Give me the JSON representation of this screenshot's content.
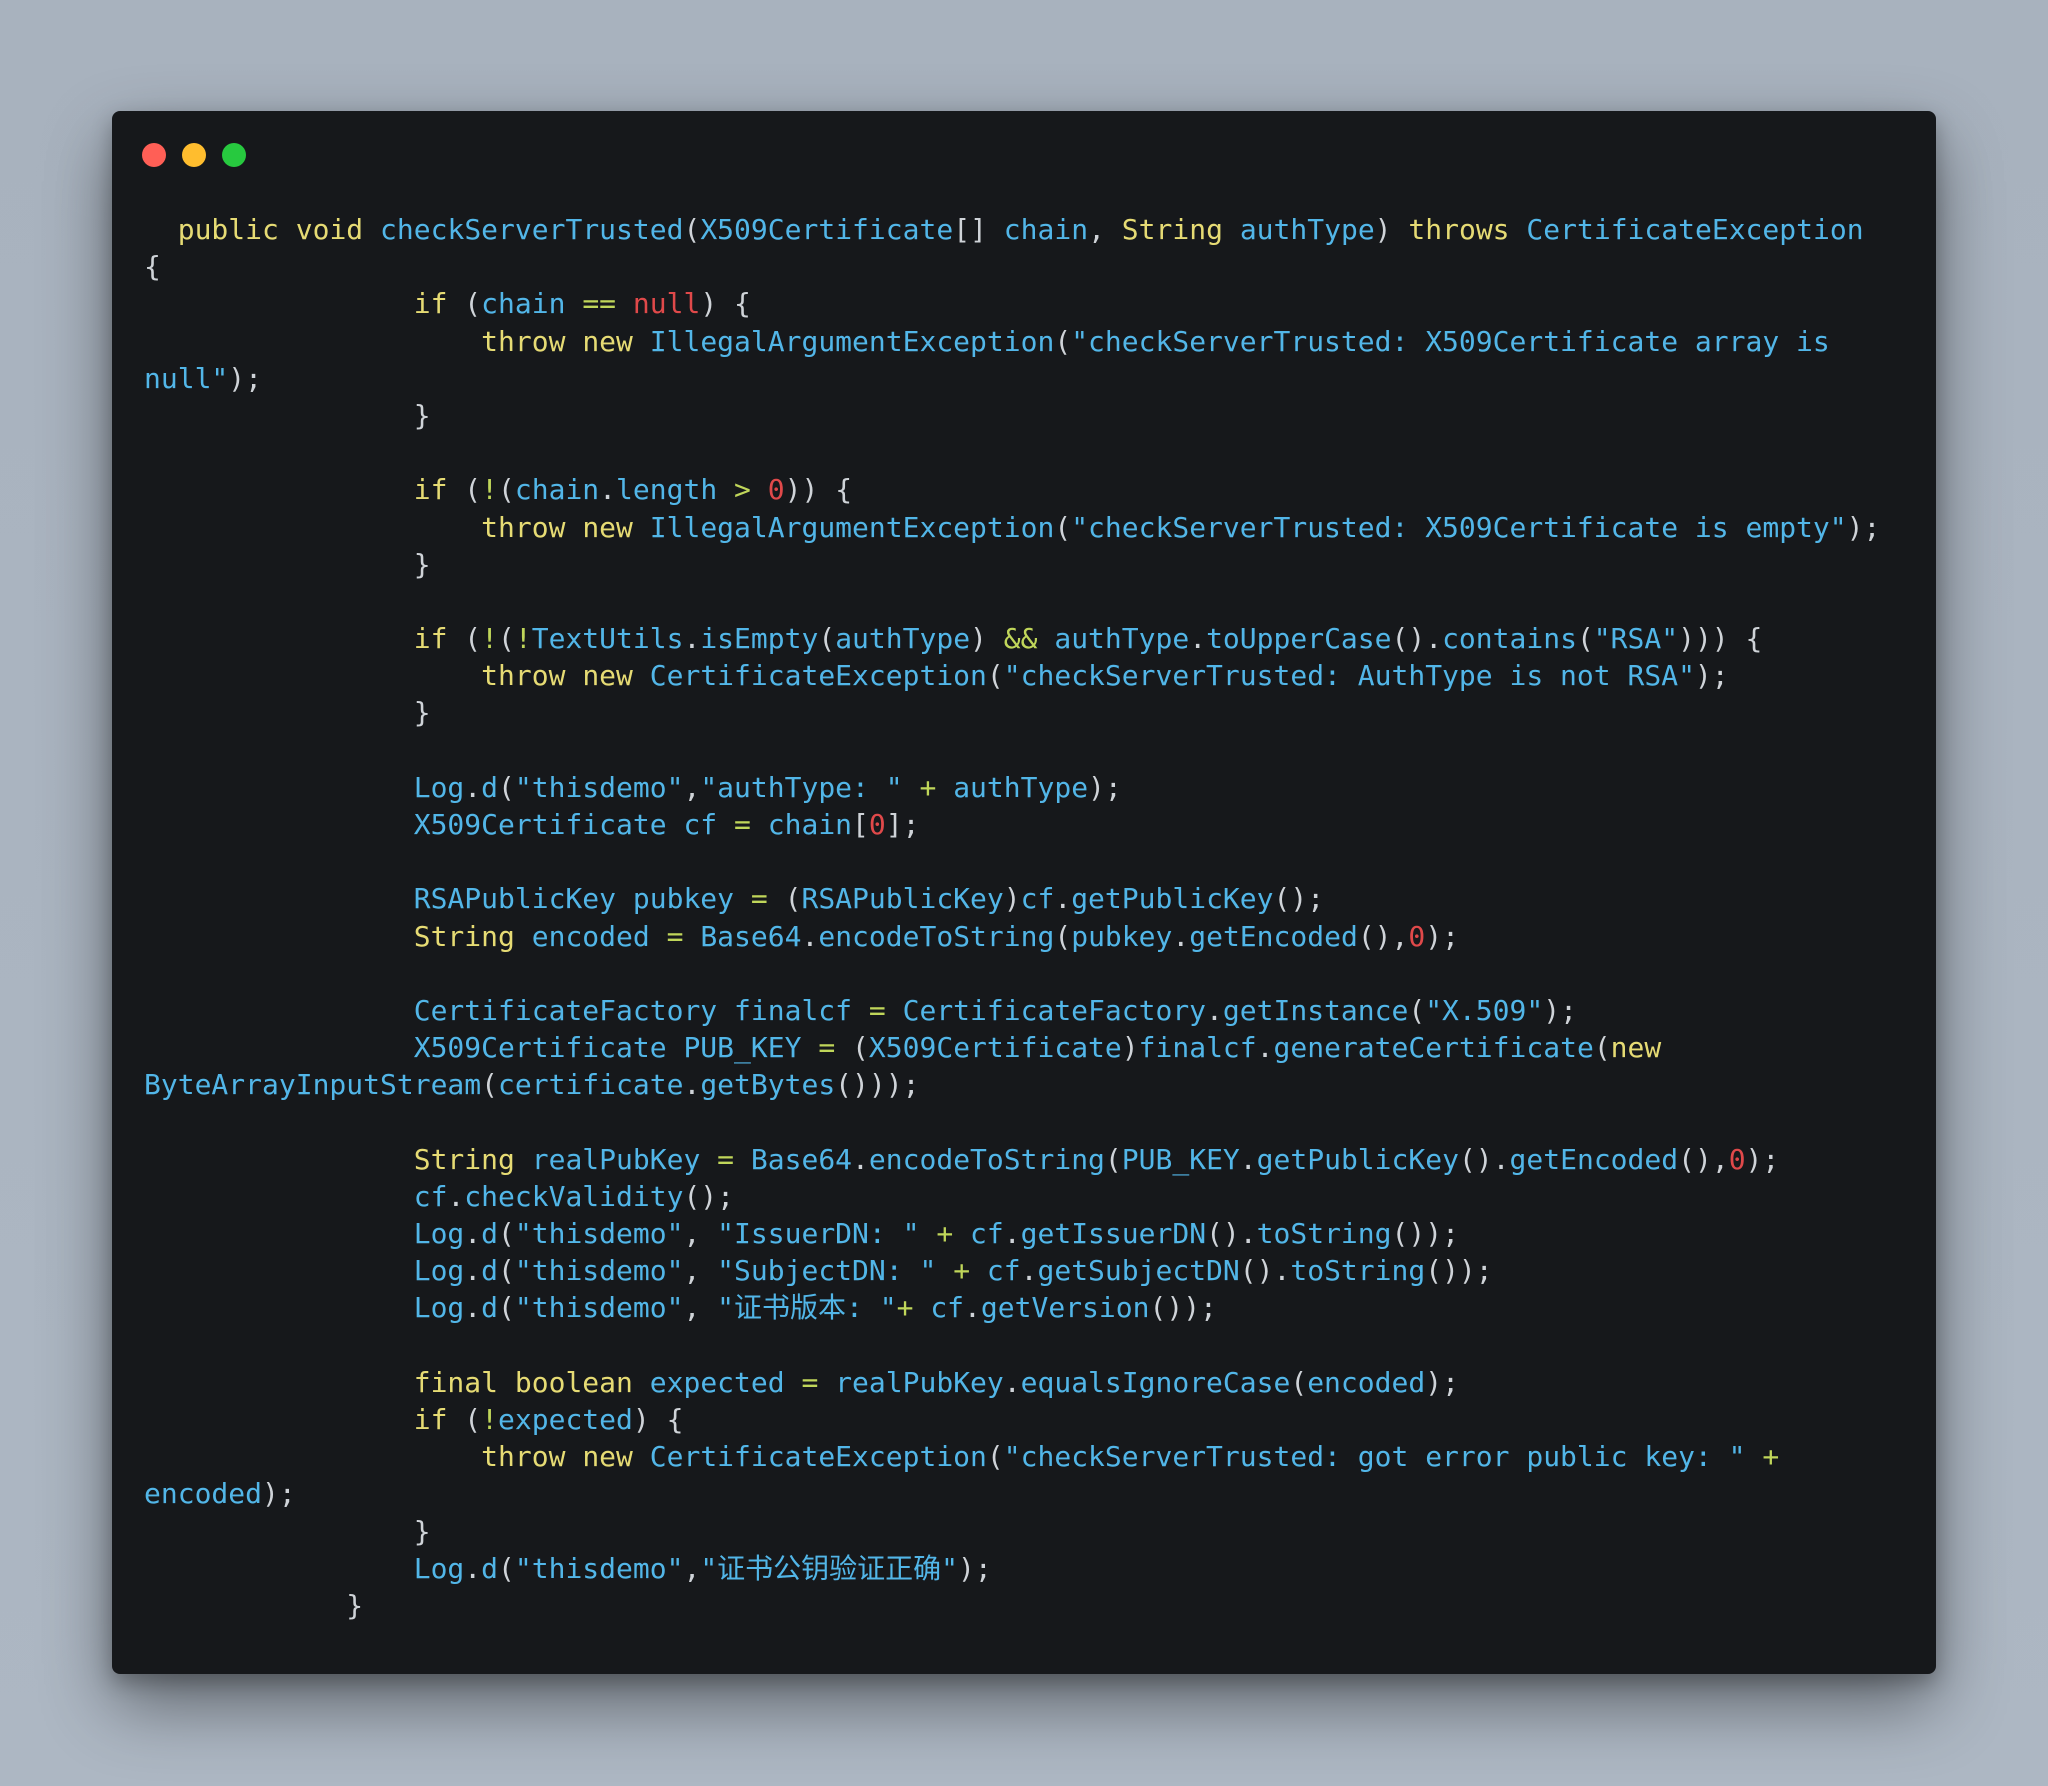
{
  "window": {
    "controls": [
      "close",
      "minimize",
      "zoom"
    ],
    "control_colors": {
      "close": "#ff5f56",
      "minimize": "#ffbd2e",
      "zoom": "#27c93f"
    }
  },
  "code": {
    "language": "java",
    "lines": [
      [
        [
          "pun",
          "  "
        ],
        [
          "kw",
          "public"
        ],
        [
          "pun",
          " "
        ],
        [
          "kw",
          "void"
        ],
        [
          "pun",
          " "
        ],
        [
          "fn",
          "checkServerTrusted"
        ],
        [
          "pun",
          "("
        ],
        [
          "id",
          "X509Certificate"
        ],
        [
          "pun",
          "[] "
        ],
        [
          "id",
          "chain"
        ],
        [
          "pun",
          ", "
        ],
        [
          "ty",
          "String"
        ],
        [
          "pun",
          " "
        ],
        [
          "id",
          "authType"
        ],
        [
          "pun",
          ") "
        ],
        [
          "kw",
          "throws"
        ],
        [
          "pun",
          " "
        ],
        [
          "id",
          "CertificateException"
        ]
      ],
      [
        [
          "pun",
          "{"
        ]
      ],
      [
        [
          "pun",
          "                "
        ],
        [
          "kw",
          "if"
        ],
        [
          "pun",
          " ("
        ],
        [
          "id",
          "chain"
        ],
        [
          "pun",
          " "
        ],
        [
          "op",
          "=="
        ],
        [
          "pun",
          " "
        ],
        [
          "nul",
          "null"
        ],
        [
          "pun",
          ") {"
        ]
      ],
      [
        [
          "pun",
          "                    "
        ],
        [
          "kw",
          "throw"
        ],
        [
          "pun",
          " "
        ],
        [
          "kw",
          "new"
        ],
        [
          "pun",
          " "
        ],
        [
          "fn",
          "IllegalArgumentException"
        ],
        [
          "pun",
          "("
        ],
        [
          "str",
          "\"checkServerTrusted: X509Certificate array is"
        ]
      ],
      [
        [
          "str",
          "null\""
        ],
        [
          "pun",
          ");"
        ]
      ],
      [
        [
          "pun",
          "                }"
        ]
      ],
      [
        [
          "pun",
          ""
        ]
      ],
      [
        [
          "pun",
          "                "
        ],
        [
          "kw",
          "if"
        ],
        [
          "pun",
          " ("
        ],
        [
          "op",
          "!"
        ],
        [
          "pun",
          "("
        ],
        [
          "id",
          "chain"
        ],
        [
          "pun",
          "."
        ],
        [
          "id",
          "length"
        ],
        [
          "pun",
          " "
        ],
        [
          "op",
          ">"
        ],
        [
          "pun",
          " "
        ],
        [
          "num",
          "0"
        ],
        [
          "pun",
          ")) {"
        ]
      ],
      [
        [
          "pun",
          "                    "
        ],
        [
          "kw",
          "throw"
        ],
        [
          "pun",
          " "
        ],
        [
          "kw",
          "new"
        ],
        [
          "pun",
          " "
        ],
        [
          "fn",
          "IllegalArgumentException"
        ],
        [
          "pun",
          "("
        ],
        [
          "str",
          "\"checkServerTrusted: X509Certificate is empty\""
        ],
        [
          "pun",
          ");"
        ]
      ],
      [
        [
          "pun",
          "                }"
        ]
      ],
      [
        [
          "pun",
          ""
        ]
      ],
      [
        [
          "pun",
          "                "
        ],
        [
          "kw",
          "if"
        ],
        [
          "pun",
          " ("
        ],
        [
          "op",
          "!"
        ],
        [
          "pun",
          "("
        ],
        [
          "op",
          "!"
        ],
        [
          "id",
          "TextUtils"
        ],
        [
          "pun",
          "."
        ],
        [
          "fn",
          "isEmpty"
        ],
        [
          "pun",
          "("
        ],
        [
          "id",
          "authType"
        ],
        [
          "pun",
          ") "
        ],
        [
          "op",
          "&&"
        ],
        [
          "pun",
          " "
        ],
        [
          "id",
          "authType"
        ],
        [
          "pun",
          "."
        ],
        [
          "fn",
          "toUpperCase"
        ],
        [
          "pun",
          "()."
        ],
        [
          "fn",
          "contains"
        ],
        [
          "pun",
          "("
        ],
        [
          "str",
          "\"RSA\""
        ],
        [
          "pun",
          "))) {"
        ]
      ],
      [
        [
          "pun",
          "                    "
        ],
        [
          "kw",
          "throw"
        ],
        [
          "pun",
          " "
        ],
        [
          "kw",
          "new"
        ],
        [
          "pun",
          " "
        ],
        [
          "fn",
          "CertificateException"
        ],
        [
          "pun",
          "("
        ],
        [
          "str",
          "\"checkServerTrusted: AuthType is not RSA\""
        ],
        [
          "pun",
          ");"
        ]
      ],
      [
        [
          "pun",
          "                }"
        ]
      ],
      [
        [
          "pun",
          ""
        ]
      ],
      [
        [
          "pun",
          "                "
        ],
        [
          "id",
          "Log"
        ],
        [
          "pun",
          "."
        ],
        [
          "fn",
          "d"
        ],
        [
          "pun",
          "("
        ],
        [
          "str",
          "\"thisdemo\""
        ],
        [
          "pun",
          ","
        ],
        [
          "str",
          "\"authType: \""
        ],
        [
          "pun",
          " "
        ],
        [
          "op",
          "+"
        ],
        [
          "pun",
          " "
        ],
        [
          "id",
          "authType"
        ],
        [
          "pun",
          ");"
        ]
      ],
      [
        [
          "pun",
          "                "
        ],
        [
          "id",
          "X509Certificate"
        ],
        [
          "pun",
          " "
        ],
        [
          "id",
          "cf"
        ],
        [
          "pun",
          " "
        ],
        [
          "op",
          "="
        ],
        [
          "pun",
          " "
        ],
        [
          "id",
          "chain"
        ],
        [
          "pun",
          "["
        ],
        [
          "num",
          "0"
        ],
        [
          "pun",
          "];"
        ]
      ],
      [
        [
          "pun",
          ""
        ]
      ],
      [
        [
          "pun",
          "                "
        ],
        [
          "id",
          "RSAPublicKey"
        ],
        [
          "pun",
          " "
        ],
        [
          "id",
          "pubkey"
        ],
        [
          "pun",
          " "
        ],
        [
          "op",
          "="
        ],
        [
          "pun",
          " ("
        ],
        [
          "id",
          "RSAPublicKey"
        ],
        [
          "pun",
          ")"
        ],
        [
          "id",
          "cf"
        ],
        [
          "pun",
          "."
        ],
        [
          "fn",
          "getPublicKey"
        ],
        [
          "pun",
          "();"
        ]
      ],
      [
        [
          "pun",
          "                "
        ],
        [
          "ty",
          "String"
        ],
        [
          "pun",
          " "
        ],
        [
          "id",
          "encoded"
        ],
        [
          "pun",
          " "
        ],
        [
          "op",
          "="
        ],
        [
          "pun",
          " "
        ],
        [
          "id",
          "Base64"
        ],
        [
          "pun",
          "."
        ],
        [
          "fn",
          "encodeToString"
        ],
        [
          "pun",
          "("
        ],
        [
          "id",
          "pubkey"
        ],
        [
          "pun",
          "."
        ],
        [
          "fn",
          "getEncoded"
        ],
        [
          "pun",
          "(),"
        ],
        [
          "num",
          "0"
        ],
        [
          "pun",
          ");"
        ]
      ],
      [
        [
          "pun",
          ""
        ]
      ],
      [
        [
          "pun",
          "                "
        ],
        [
          "id",
          "CertificateFactory"
        ],
        [
          "pun",
          " "
        ],
        [
          "id",
          "finalcf"
        ],
        [
          "pun",
          " "
        ],
        [
          "op",
          "="
        ],
        [
          "pun",
          " "
        ],
        [
          "id",
          "CertificateFactory"
        ],
        [
          "pun",
          "."
        ],
        [
          "fn",
          "getInstance"
        ],
        [
          "pun",
          "("
        ],
        [
          "str",
          "\"X.509\""
        ],
        [
          "pun",
          ");"
        ]
      ],
      [
        [
          "pun",
          "                "
        ],
        [
          "id",
          "X509Certificate"
        ],
        [
          "pun",
          " "
        ],
        [
          "id",
          "PUB_KEY"
        ],
        [
          "pun",
          " "
        ],
        [
          "op",
          "="
        ],
        [
          "pun",
          " ("
        ],
        [
          "id",
          "X509Certificate"
        ],
        [
          "pun",
          ")"
        ],
        [
          "id",
          "finalcf"
        ],
        [
          "pun",
          "."
        ],
        [
          "fn",
          "generateCertificate"
        ],
        [
          "pun",
          "("
        ],
        [
          "kw",
          "new"
        ]
      ],
      [
        [
          "id",
          "ByteArrayInputStream"
        ],
        [
          "pun",
          "("
        ],
        [
          "id",
          "certificate"
        ],
        [
          "pun",
          "."
        ],
        [
          "fn",
          "getBytes"
        ],
        [
          "pun",
          "()));"
        ]
      ],
      [
        [
          "pun",
          ""
        ]
      ],
      [
        [
          "pun",
          "                "
        ],
        [
          "ty",
          "String"
        ],
        [
          "pun",
          " "
        ],
        [
          "id",
          "realPubKey"
        ],
        [
          "pun",
          " "
        ],
        [
          "op",
          "="
        ],
        [
          "pun",
          " "
        ],
        [
          "id",
          "Base64"
        ],
        [
          "pun",
          "."
        ],
        [
          "fn",
          "encodeToString"
        ],
        [
          "pun",
          "("
        ],
        [
          "id",
          "PUB_KEY"
        ],
        [
          "pun",
          "."
        ],
        [
          "fn",
          "getPublicKey"
        ],
        [
          "pun",
          "()."
        ],
        [
          "fn",
          "getEncoded"
        ],
        [
          "pun",
          "(),"
        ],
        [
          "num",
          "0"
        ],
        [
          "pun",
          ");"
        ]
      ],
      [
        [
          "pun",
          "                "
        ],
        [
          "id",
          "cf"
        ],
        [
          "pun",
          "."
        ],
        [
          "fn",
          "checkValidity"
        ],
        [
          "pun",
          "();"
        ]
      ],
      [
        [
          "pun",
          "                "
        ],
        [
          "id",
          "Log"
        ],
        [
          "pun",
          "."
        ],
        [
          "fn",
          "d"
        ],
        [
          "pun",
          "("
        ],
        [
          "str",
          "\"thisdemo\""
        ],
        [
          "pun",
          ", "
        ],
        [
          "str",
          "\"IssuerDN: \""
        ],
        [
          "pun",
          " "
        ],
        [
          "op",
          "+"
        ],
        [
          "pun",
          " "
        ],
        [
          "id",
          "cf"
        ],
        [
          "pun",
          "."
        ],
        [
          "fn",
          "getIssuerDN"
        ],
        [
          "pun",
          "()."
        ],
        [
          "fn",
          "toString"
        ],
        [
          "pun",
          "());"
        ]
      ],
      [
        [
          "pun",
          "                "
        ],
        [
          "id",
          "Log"
        ],
        [
          "pun",
          "."
        ],
        [
          "fn",
          "d"
        ],
        [
          "pun",
          "("
        ],
        [
          "str",
          "\"thisdemo\""
        ],
        [
          "pun",
          ", "
        ],
        [
          "str",
          "\"SubjectDN: \""
        ],
        [
          "pun",
          " "
        ],
        [
          "op",
          "+"
        ],
        [
          "pun",
          " "
        ],
        [
          "id",
          "cf"
        ],
        [
          "pun",
          "."
        ],
        [
          "fn",
          "getSubjectDN"
        ],
        [
          "pun",
          "()."
        ],
        [
          "fn",
          "toString"
        ],
        [
          "pun",
          "());"
        ]
      ],
      [
        [
          "pun",
          "                "
        ],
        [
          "id",
          "Log"
        ],
        [
          "pun",
          "."
        ],
        [
          "fn",
          "d"
        ],
        [
          "pun",
          "("
        ],
        [
          "str",
          "\"thisdemo\""
        ],
        [
          "pun",
          ", "
        ],
        [
          "str",
          "\"证书版本: \""
        ],
        [
          "op",
          "+"
        ],
        [
          "pun",
          " "
        ],
        [
          "id",
          "cf"
        ],
        [
          "pun",
          "."
        ],
        [
          "fn",
          "getVersion"
        ],
        [
          "pun",
          "());"
        ]
      ],
      [
        [
          "pun",
          ""
        ]
      ],
      [
        [
          "pun",
          "                "
        ],
        [
          "kw",
          "final"
        ],
        [
          "pun",
          " "
        ],
        [
          "ty",
          "boolean"
        ],
        [
          "pun",
          " "
        ],
        [
          "id",
          "expected"
        ],
        [
          "pun",
          " "
        ],
        [
          "op",
          "="
        ],
        [
          "pun",
          " "
        ],
        [
          "id",
          "realPubKey"
        ],
        [
          "pun",
          "."
        ],
        [
          "fn",
          "equalsIgnoreCase"
        ],
        [
          "pun",
          "("
        ],
        [
          "id",
          "encoded"
        ],
        [
          "pun",
          ");"
        ]
      ],
      [
        [
          "pun",
          "                "
        ],
        [
          "kw",
          "if"
        ],
        [
          "pun",
          " ("
        ],
        [
          "op",
          "!"
        ],
        [
          "id",
          "expected"
        ],
        [
          "pun",
          ") {"
        ]
      ],
      [
        [
          "pun",
          "                    "
        ],
        [
          "kw",
          "throw"
        ],
        [
          "pun",
          " "
        ],
        [
          "kw",
          "new"
        ],
        [
          "pun",
          " "
        ],
        [
          "fn",
          "CertificateException"
        ],
        [
          "pun",
          "("
        ],
        [
          "str",
          "\"checkServerTrusted: got error public key: \""
        ],
        [
          "pun",
          " "
        ],
        [
          "op",
          "+"
        ]
      ],
      [
        [
          "id",
          "encoded"
        ],
        [
          "pun",
          ");"
        ]
      ],
      [
        [
          "pun",
          "                }"
        ]
      ],
      [
        [
          "pun",
          "                "
        ],
        [
          "id",
          "Log"
        ],
        [
          "pun",
          "."
        ],
        [
          "fn",
          "d"
        ],
        [
          "pun",
          "("
        ],
        [
          "str",
          "\"thisdemo\""
        ],
        [
          "pun",
          ","
        ],
        [
          "str",
          "\"证书公钥验证正确\""
        ],
        [
          "pun",
          ");"
        ]
      ],
      [
        [
          "pun",
          "            }"
        ]
      ]
    ]
  }
}
